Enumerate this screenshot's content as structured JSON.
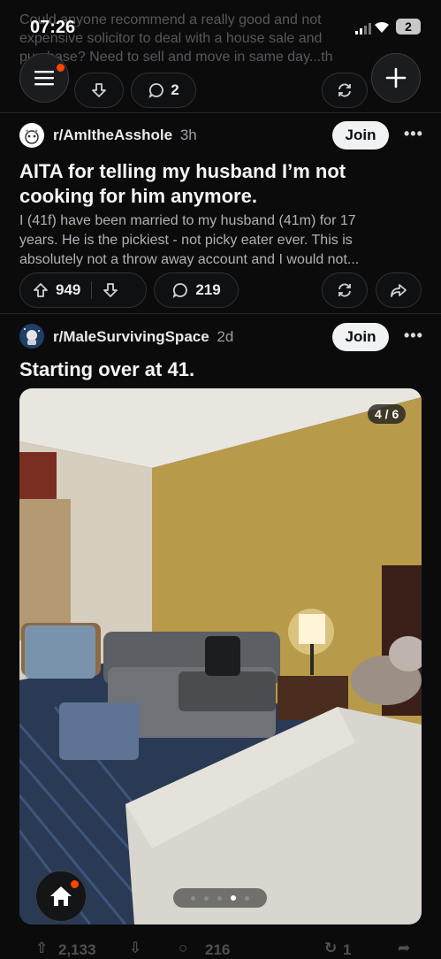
{
  "status_bar": {
    "time": "07:26",
    "battery": "2"
  },
  "prev_post": {
    "snippet_line1": "Could anyone recommend a really good and not",
    "snippet_line2": "expensive solicitor to deal with a house sale and",
    "snippet_line3": "purchase? Need to sell and move in same day...th",
    "comments": "2"
  },
  "post1": {
    "subreddit": "r/AmItheAsshole",
    "age": "3h",
    "join_label": "Join",
    "title_line1": "AITA for telling my husband I’m not",
    "title_line2": "cooking for him anymore.",
    "body_line1": "I (41f) have been married to my husband (41m) for 17",
    "body_line2": "years. He is the pickiest - not picky eater ever. This is",
    "body_line3": "absolutely not a throw away account and I would not...",
    "votes": "949",
    "comments": "219"
  },
  "post2": {
    "subreddit": "r/MaleSurvivingSpace",
    "age": "2d",
    "join_label": "Join",
    "title": "Starting over at 41.",
    "image_counter": "4 / 6",
    "votes": "2,133",
    "comments": "216",
    "shares": "1"
  },
  "colors": {
    "accent": "#ff4500",
    "background": "#0b0b0c"
  }
}
